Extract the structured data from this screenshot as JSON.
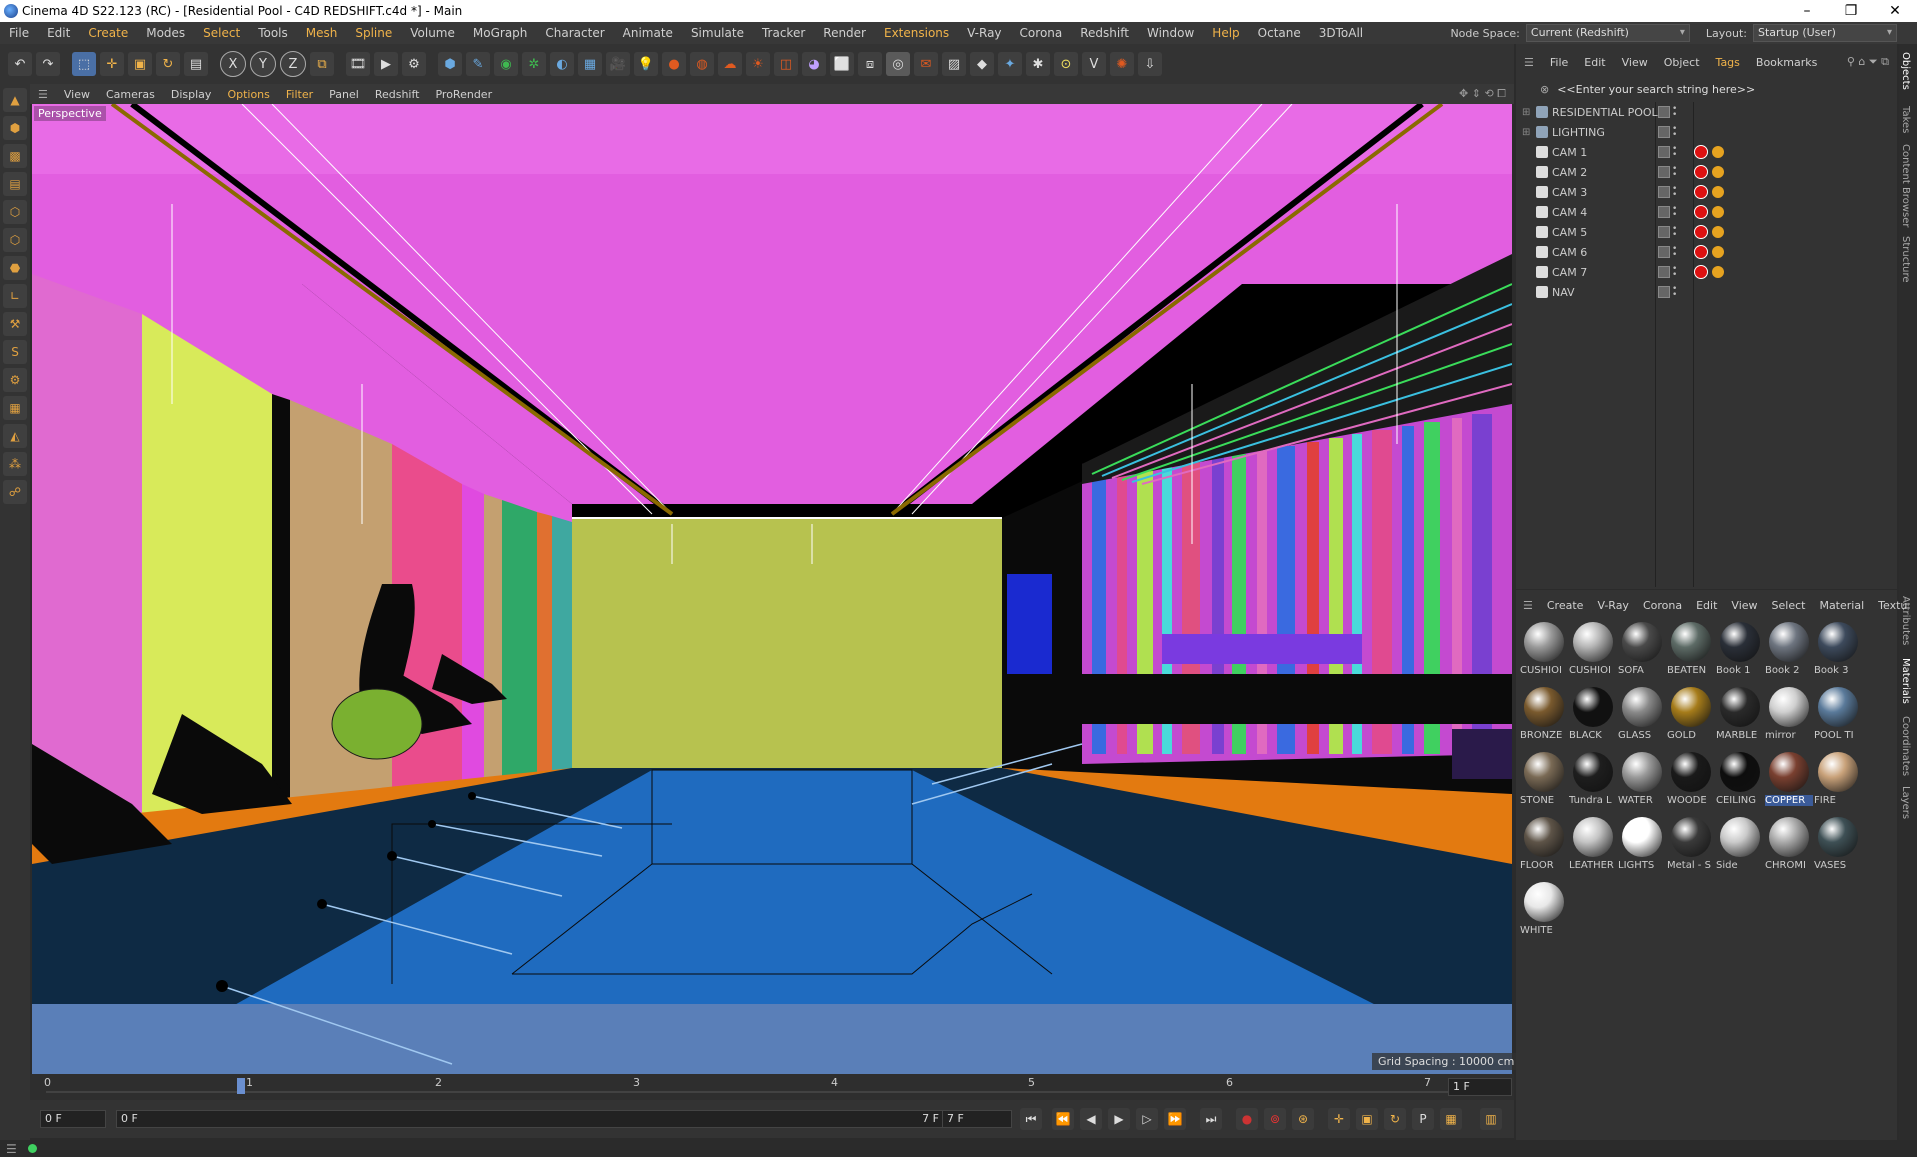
{
  "window": {
    "title": "Cinema 4D S22.123 (RC) - [Residential Pool - C4D REDSHIFT.c4d *] - Main",
    "controls": [
      "–",
      "❐",
      "✕"
    ]
  },
  "menubar": {
    "items": [
      "File",
      "Edit",
      "Create",
      "Modes",
      "Select",
      "Tools",
      "Mesh",
      "Spline",
      "Volume",
      "MoGraph",
      "Character",
      "Animate",
      "Simulate",
      "Tracker",
      "Render",
      "Extensions",
      "V-Ray",
      "Corona",
      "Redshift",
      "Window",
      "Help",
      "Octane",
      "3DToAll"
    ],
    "highlighted": [
      "Create",
      "Select",
      "Mesh",
      "Spline",
      "Extensions",
      "Help"
    ],
    "node_space_label": "Node Space:",
    "node_space_value": "Current (Redshift)",
    "layout_label": "Layout:",
    "layout_value": "Startup (User)"
  },
  "toolbar": {
    "axis_x": "X",
    "axis_y": "Y",
    "axis_z": "Z"
  },
  "viewport": {
    "menu": [
      "View",
      "Cameras",
      "Display",
      "Options",
      "Filter",
      "Panel",
      "Redshift",
      "ProRender"
    ],
    "highlighted": [
      "Options",
      "Filter"
    ],
    "label": "Perspective",
    "grid_spacing": "Grid Spacing : 10000 cm"
  },
  "timeline": {
    "ticks": [
      "0",
      "1",
      "2",
      "3",
      "4",
      "5",
      "6",
      "7"
    ],
    "current_frame_right": "1 F",
    "start_field": "0 F",
    "range_start": "0 F",
    "range_end": "7 F",
    "end_field": "7 F"
  },
  "object_manager": {
    "menu": [
      "File",
      "Edit",
      "View",
      "Object",
      "Tags",
      "Bookmarks"
    ],
    "highlighted": [
      "Tags"
    ],
    "search_placeholder": "<<Enter your search string here>>",
    "objects": [
      {
        "name": "RESIDENTIAL POOL",
        "type": "group",
        "tags": false
      },
      {
        "name": "LIGHTING",
        "type": "group",
        "tags": false
      },
      {
        "name": "CAM 1",
        "type": "camera",
        "tags": true
      },
      {
        "name": "CAM 2",
        "type": "camera",
        "tags": true
      },
      {
        "name": "CAM 3",
        "type": "camera",
        "tags": true
      },
      {
        "name": "CAM 4",
        "type": "camera",
        "tags": true
      },
      {
        "name": "CAM 5",
        "type": "camera",
        "tags": true
      },
      {
        "name": "CAM 6",
        "type": "camera",
        "tags": true
      },
      {
        "name": "CAM 7",
        "type": "camera",
        "tags": true
      },
      {
        "name": "NAV",
        "type": "camera",
        "tags": false
      }
    ]
  },
  "side_tabs_top": [
    "Objects",
    "Takes",
    "Content Browser",
    "Structure"
  ],
  "side_tabs_bottom": [
    "Attributes",
    "Materials",
    "Coordinates",
    "Layers"
  ],
  "material_manager": {
    "menu": [
      "Create",
      "V-Ray",
      "Corona",
      "Edit",
      "View",
      "Select",
      "Material",
      "Textu"
    ],
    "materials": [
      {
        "name": "CUSHIOI",
        "color": "#9a9a9a"
      },
      {
        "name": "CUSHIOI",
        "color": "#b5b5b5"
      },
      {
        "name": "SOFA",
        "color": "#4a4a4a"
      },
      {
        "name": "BEATEN",
        "color": "#5d6b66"
      },
      {
        "name": "Book 1",
        "color": "#2a2f38"
      },
      {
        "name": "Book 2",
        "color": "#6e7580"
      },
      {
        "name": "Book 3",
        "color": "#3d4a5c"
      },
      {
        "name": "BRONZE",
        "color": "#7a5a2e"
      },
      {
        "name": "BLACK",
        "color": "#111111"
      },
      {
        "name": "GLASS",
        "color": "#8a8a8a"
      },
      {
        "name": "GOLD",
        "color": "#a67c1a"
      },
      {
        "name": "MARBLE",
        "color": "#2a2a2a"
      },
      {
        "name": "mirror",
        "color": "#cfcfcf"
      },
      {
        "name": "POOL TI",
        "color": "#5a7a9a"
      },
      {
        "name": "STONE",
        "color": "#7a6a55"
      },
      {
        "name": "Tundra L",
        "color": "#1e1e1e"
      },
      {
        "name": "WATER",
        "color": "#9a9a9a"
      },
      {
        "name": "WOODE",
        "color": "#1a1a1a"
      },
      {
        "name": "CEILING",
        "color": "#0d0d0d"
      },
      {
        "name": "COPPER",
        "color": "#7a4030"
      },
      {
        "name": "FIRE",
        "color": "#c9a27a"
      },
      {
        "name": "FLOOR",
        "color": "#5e5448"
      },
      {
        "name": "LEATHER",
        "color": "#c4c4c4"
      },
      {
        "name": "LIGHTS",
        "color": "#ffffff"
      },
      {
        "name": "Metal - S",
        "color": "#3a3a3a"
      },
      {
        "name": "Side",
        "color": "#cacaca"
      },
      {
        "name": "CHROMI",
        "color": "#aaaaaa"
      },
      {
        "name": "VASES",
        "color": "#3e5055"
      },
      {
        "name": "WHITE",
        "color": "#e8e8e8"
      }
    ],
    "selected": "COPPER"
  },
  "colors": {
    "accent": "#f0b34a",
    "ceiling": "#e25ee0",
    "pool": "#1f6bbf",
    "deck": "#e37a10",
    "back_wall": "#b7c24f"
  },
  "icons": {
    "undo": "undo-icon",
    "redo": "redo-icon",
    "play": "play-icon",
    "hamburger": "menu-icon"
  }
}
